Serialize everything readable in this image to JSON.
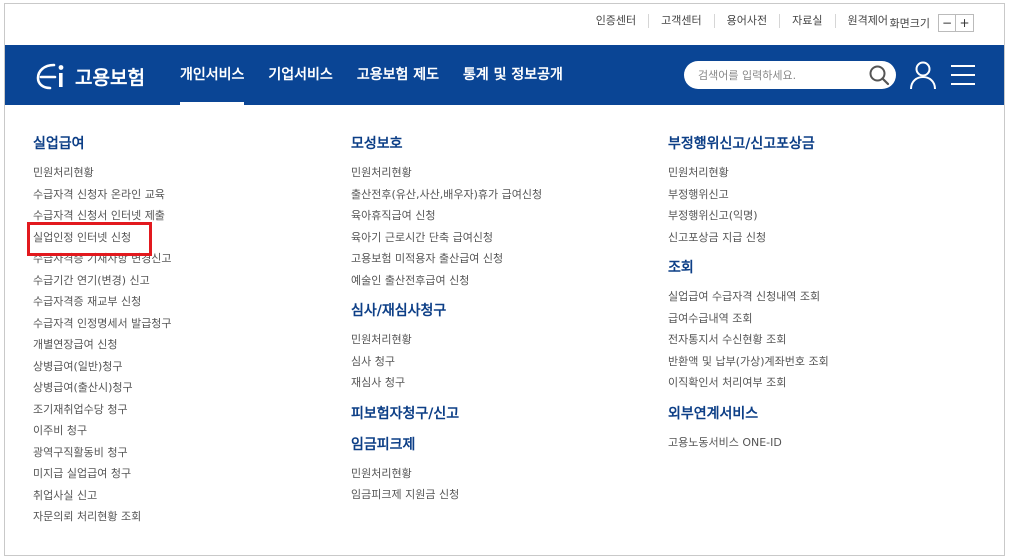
{
  "util": {
    "links": [
      "인증센터",
      "고객센터",
      "용어사전",
      "자료실",
      "원격제어"
    ],
    "font_size_label": "화면크기",
    "font_minus": "−",
    "font_plus": "+"
  },
  "header": {
    "logo_text": "고용보험",
    "nav": [
      "개인서비스",
      "기업서비스",
      "고용보험 제도",
      "통계 및 정보공개"
    ],
    "active_nav": "개인서비스",
    "search_placeholder": "검색어를 입력하세요.",
    "brand_color": "#0a4595"
  },
  "menu": {
    "col1": {
      "sections": [
        {
          "title": "실업급여",
          "items": [
            "민원처리현황",
            "수급자격 신청자 온라인 교육",
            "수급자격 신청서 인터넷 제출",
            "실업인정 인터넷 신청",
            "수급자격증 기재사항 변경신고",
            "수급기간 연기(변경) 신고",
            "수급자격증 재교부 신청",
            "수급자격 인정명세서 발급청구",
            "개별연장급여 신청",
            "상병급여(일반)청구",
            "상병급여(출산시)청구",
            "조기재취업수당 청구",
            "이주비 청구",
            "광역구직활동비 청구",
            "미지급 실업급여 청구",
            "취업사실 신고",
            "자문의뢰 처리현황 조회"
          ]
        }
      ]
    },
    "col2": {
      "sections": [
        {
          "title": "모성보호",
          "items": [
            "민원처리현황",
            "출산전후(유산,사산,배우자)휴가 급여신청",
            "육아휴직급여 신청",
            "육아기 근로시간 단축 급여신청",
            "고용보험 미적용자 출산급여 신청",
            "예술인 출산전후급여 신청"
          ]
        },
        {
          "title": "심사/재심사청구",
          "items": [
            "민원처리현황",
            "심사 청구",
            "재심사 청구"
          ]
        },
        {
          "title": "피보험자청구/신고",
          "items": []
        },
        {
          "title": "임금피크제",
          "items": [
            "민원처리현황",
            "임금피크제 지원금 신청"
          ]
        }
      ]
    },
    "col3": {
      "sections": [
        {
          "title": "부정행위신고/신고포상금",
          "items": [
            "민원처리현황",
            "부정행위신고",
            "부정행위신고(익명)",
            "신고포상금 지급 신청"
          ]
        },
        {
          "title": "조회",
          "items": [
            "실업급여 수급자격 신청내역 조회",
            "급여수급내역 조회",
            "전자통지서 수신현황 조회",
            "반환액 및 납부(가상)계좌번호 조회",
            "이직확인서 처리여부 조회"
          ]
        },
        {
          "title": "외부연계서비스",
          "items": [
            "고용노동서비스 ONE-ID"
          ]
        }
      ]
    }
  },
  "highlight": {
    "target": "실업인정 인터넷 신청",
    "color": "#e2191e"
  }
}
